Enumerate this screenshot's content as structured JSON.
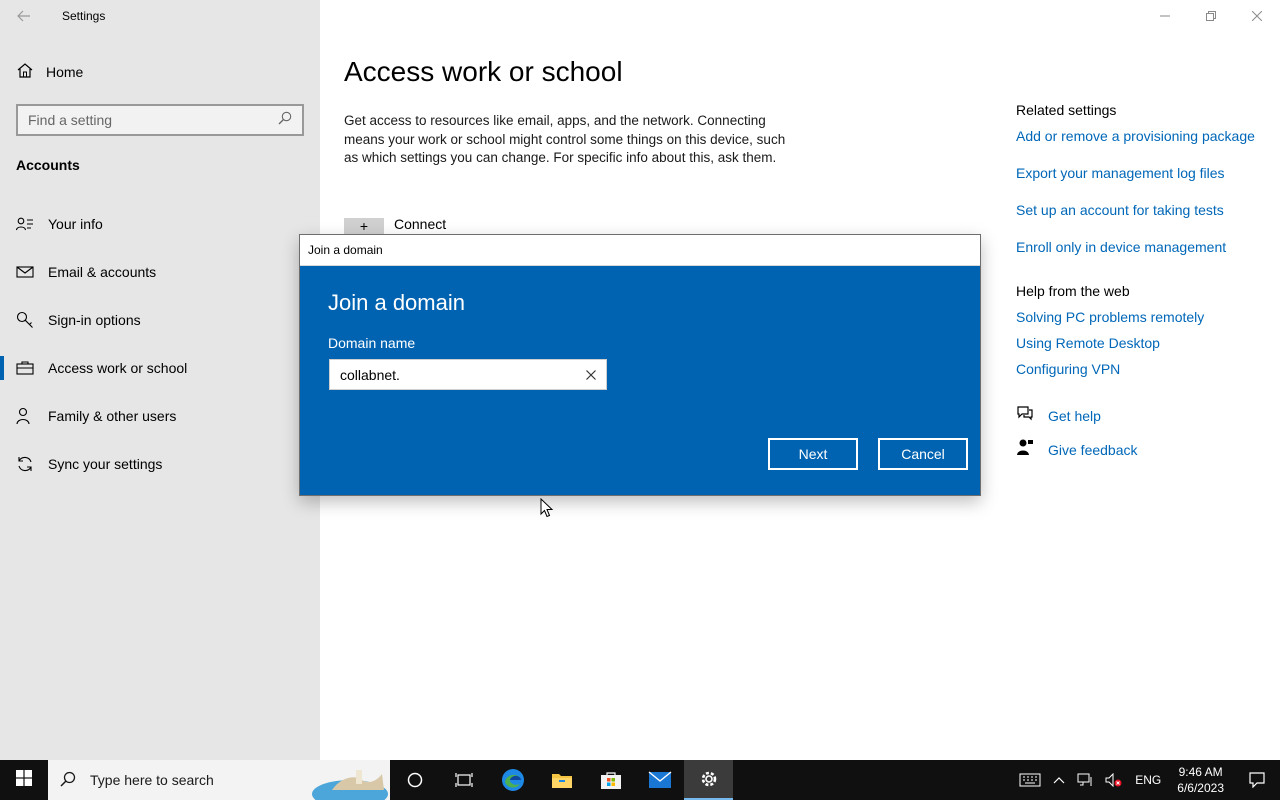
{
  "app": {
    "title": "Settings"
  },
  "sidebar": {
    "home_label": "Home",
    "search_placeholder": "Find a setting",
    "section_heading": "Accounts",
    "items": [
      {
        "label": "Your info",
        "icon": "person-card-icon"
      },
      {
        "label": "Email & accounts",
        "icon": "mail-icon"
      },
      {
        "label": "Sign-in options",
        "icon": "key-icon"
      },
      {
        "label": "Access work or school",
        "icon": "briefcase-icon",
        "active": true
      },
      {
        "label": "Family & other users",
        "icon": "person-add-icon"
      },
      {
        "label": "Sync your settings",
        "icon": "sync-icon"
      }
    ]
  },
  "main": {
    "title": "Access work or school",
    "description": "Get access to resources like email, apps, and the network. Connecting means your work or school might control some things on this device, such as which settings you can change. For specific info about this, ask them.",
    "connect_label": "Connect",
    "related": {
      "heading": "Related settings",
      "links": [
        "Add or remove a provisioning package",
        "Export your management log files",
        "Set up an account for taking tests",
        "Enroll only in device management"
      ]
    },
    "help": {
      "heading": "Help from the web",
      "links": [
        "Solving PC problems remotely",
        "Using Remote Desktop",
        "Configuring VPN"
      ]
    },
    "support": {
      "get_help": "Get help",
      "give_feedback": "Give feedback"
    }
  },
  "dialog": {
    "window_title": "Join a domain",
    "heading": "Join a domain",
    "field_label": "Domain name",
    "field_value": "collabnet.",
    "next_label": "Next",
    "cancel_label": "Cancel"
  },
  "taskbar": {
    "search_placeholder": "Type here to search",
    "language": "ENG",
    "time": "9:46 AM",
    "date": "6/6/2023"
  },
  "colors": {
    "accent": "#0063b1",
    "link": "#0067b8",
    "sidebar_bg": "#e6e6e6",
    "taskbar_bg": "#101010"
  }
}
